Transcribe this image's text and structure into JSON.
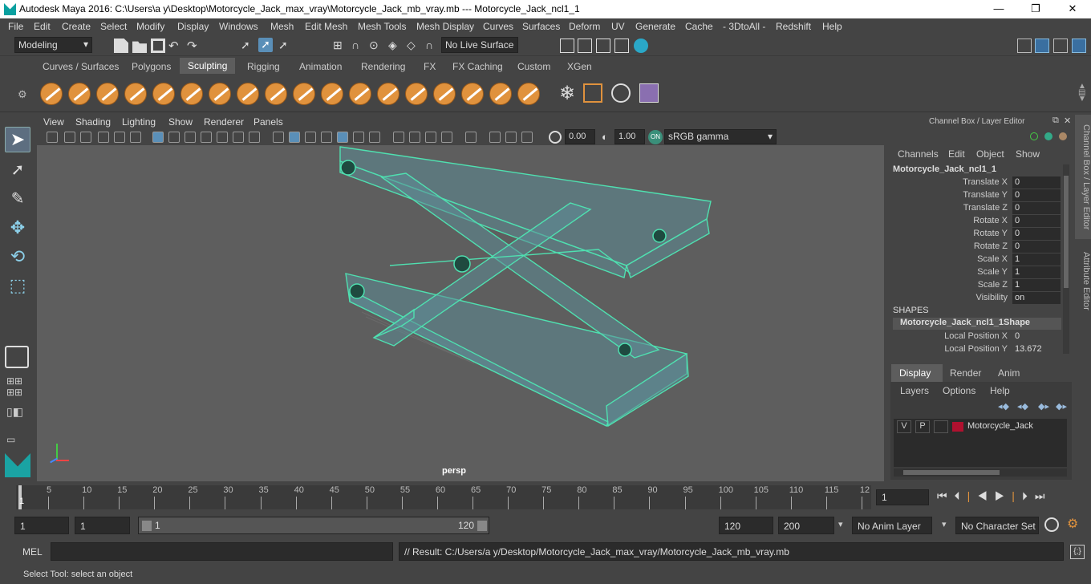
{
  "window": {
    "title": "Autodesk Maya 2016: C:\\Users\\a y\\Desktop\\Motorcycle_Jack_max_vray\\Motorcycle_Jack_mb_vray.mb   ---   Motorcycle_Jack_ncl1_1",
    "minimize": "—",
    "maximize": "❐",
    "close": "✕"
  },
  "menu": [
    "File",
    "Edit",
    "Create",
    "Select",
    "Modify",
    "Display",
    "Windows",
    "Mesh",
    "Edit Mesh",
    "Mesh Tools",
    "Mesh Display",
    "Curves",
    "Surfaces",
    "Deform",
    "UV",
    "Generate",
    "Cache",
    "- 3DtoAll -",
    "Redshift",
    "Help"
  ],
  "status": {
    "mode": "Modeling",
    "live_surface": "No Live Surface"
  },
  "shelf_tabs": [
    "Curves / Surfaces",
    "Polygons",
    "Sculpting",
    "Rigging",
    "Animation",
    "Rendering",
    "FX",
    "FX Caching",
    "Custom",
    "XGen"
  ],
  "shelf_active": "Sculpting",
  "panel_menu": [
    "View",
    "Shading",
    "Lighting",
    "Show",
    "Renderer",
    "Panels"
  ],
  "panel_toolbar": {
    "exposure": "0.00",
    "gamma": "1.00",
    "colorspace": "sRGB gamma"
  },
  "viewport": {
    "camera_label": "persp"
  },
  "channel_box": {
    "header": "Channel Box / Layer Editor",
    "menus": [
      "Channels",
      "Edit",
      "Object",
      "Show"
    ],
    "object": "Motorcycle_Jack_ncl1_1",
    "attrs": [
      {
        "name": "Translate X",
        "value": "0"
      },
      {
        "name": "Translate Y",
        "value": "0"
      },
      {
        "name": "Translate Z",
        "value": "0"
      },
      {
        "name": "Rotate X",
        "value": "0"
      },
      {
        "name": "Rotate Y",
        "value": "0"
      },
      {
        "name": "Rotate Z",
        "value": "0"
      },
      {
        "name": "Scale X",
        "value": "1"
      },
      {
        "name": "Scale Y",
        "value": "1"
      },
      {
        "name": "Scale Z",
        "value": "1"
      },
      {
        "name": "Visibility",
        "value": "on"
      }
    ],
    "shapes_label": "SHAPES",
    "shape_name": "Motorcycle_Jack_ncl1_1Shape",
    "shape_attrs": [
      {
        "name": "Local Position X",
        "value": "0"
      },
      {
        "name": "Local Position Y",
        "value": "13.672"
      }
    ]
  },
  "layer_editor": {
    "tabs": [
      "Display",
      "Render",
      "Anim"
    ],
    "menus": [
      "Layers",
      "Options",
      "Help"
    ],
    "layer": {
      "v": "V",
      "p": "P",
      "name": "Motorcycle_Jack",
      "color": "#b0112f"
    }
  },
  "side_tabs": {
    "channel_box": "Channel Box / Layer Editor",
    "attribute_editor": "Attribute Editor"
  },
  "timeline": {
    "ticks": [
      "5",
      "10",
      "15",
      "20",
      "25",
      "30",
      "35",
      "40",
      "45",
      "50",
      "55",
      "60",
      "65",
      "70",
      "75",
      "80",
      "85",
      "90",
      "95",
      "100",
      "105",
      "110",
      "115",
      "12"
    ],
    "start_label": "1",
    "current_frame": "1"
  },
  "range": {
    "start": "1",
    "playback_start": "1",
    "slider_start": "1",
    "slider_end": "120",
    "playback_end": "120",
    "end": "200",
    "anim_layer": "No Anim Layer",
    "char_set": "No Character Set"
  },
  "mel": {
    "label": "MEL",
    "result": "// Result: C:/Users/a y/Desktop/Motorcycle_Jack_max_vray/Motorcycle_Jack_mb_vray.mb"
  },
  "help": "Select Tool: select an object",
  "colors": {
    "wire": "#4fe0b0",
    "accent": "#e0923d"
  }
}
